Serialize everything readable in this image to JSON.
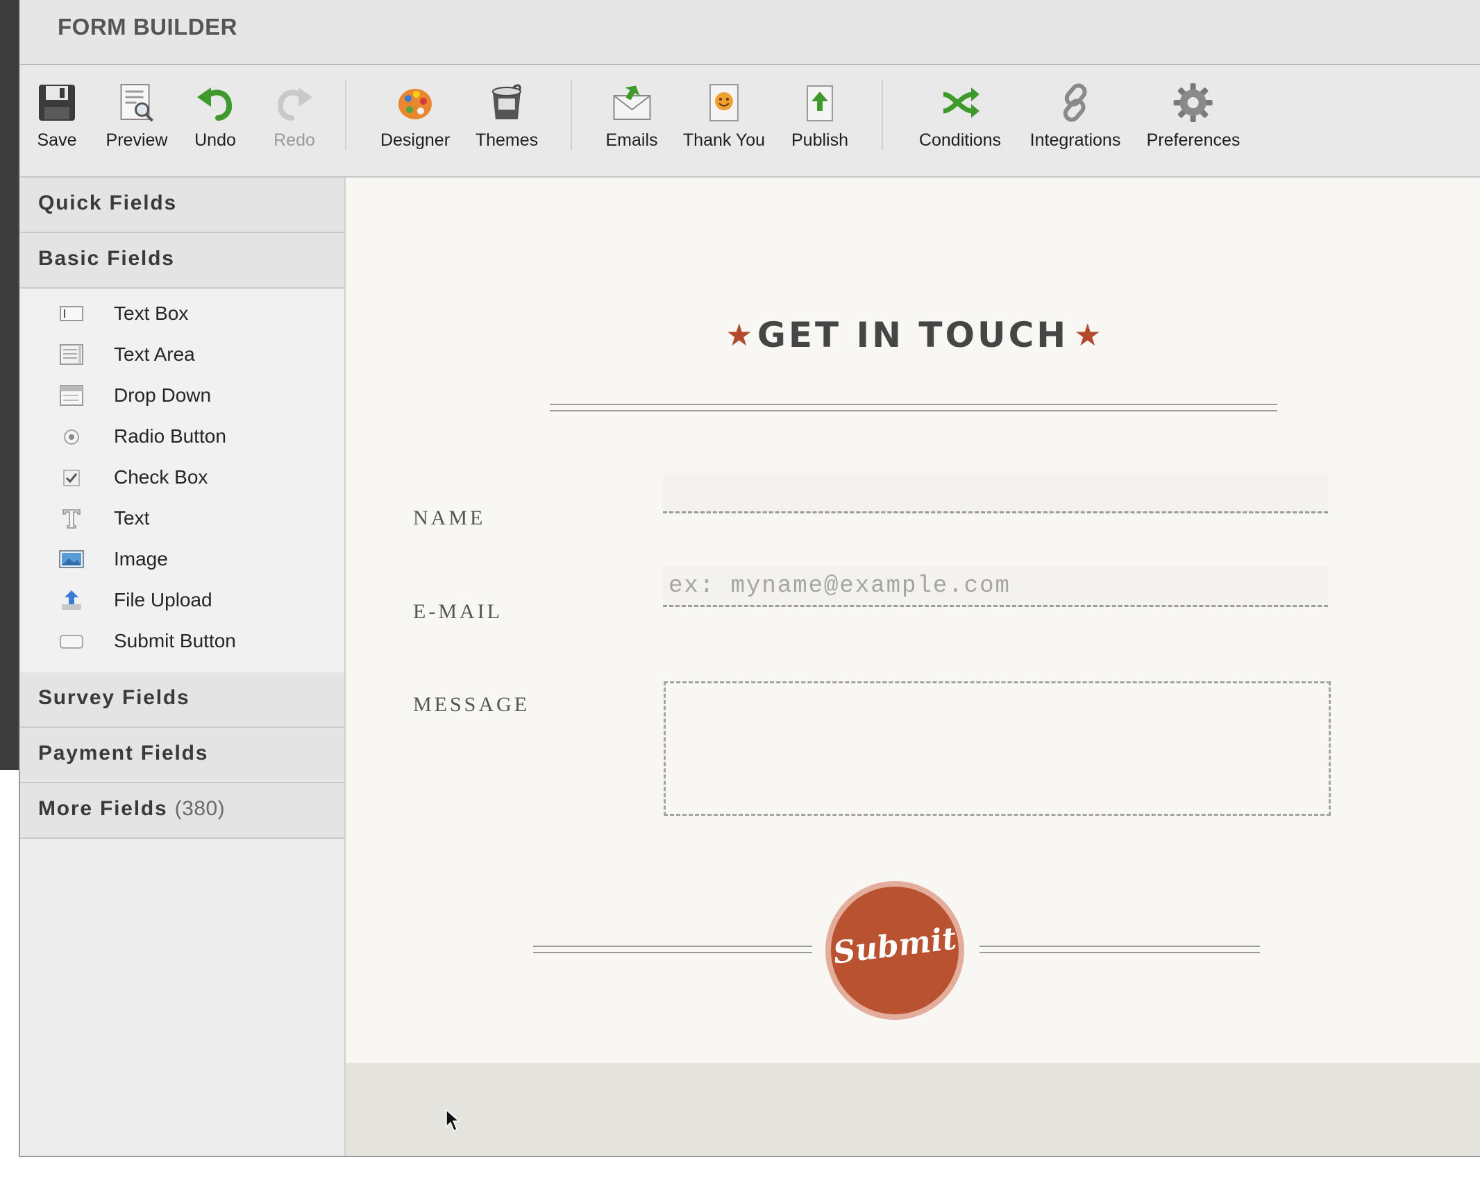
{
  "app": {
    "title": "FORM BUILDER"
  },
  "toolbar": {
    "items": [
      {
        "label": "Save",
        "icon": "floppy-disk-icon",
        "disabled": false
      },
      {
        "label": "Preview",
        "icon": "preview-icon",
        "disabled": false
      },
      {
        "label": "Undo",
        "icon": "undo-arrow-icon",
        "disabled": false
      },
      {
        "label": "Redo",
        "icon": "redo-arrow-icon",
        "disabled": true
      },
      {
        "label": "Designer",
        "icon": "palette-icon",
        "disabled": false
      },
      {
        "label": "Themes",
        "icon": "paint-bucket-icon",
        "disabled": false
      },
      {
        "label": "Emails",
        "icon": "envelope-icon",
        "disabled": false
      },
      {
        "label": "Thank You",
        "icon": "smiley-page-icon",
        "disabled": false
      },
      {
        "label": "Publish",
        "icon": "upload-page-icon",
        "disabled": false
      },
      {
        "label": "Conditions",
        "icon": "crossing-arrows-icon",
        "disabled": false
      },
      {
        "label": "Integrations",
        "icon": "chain-link-icon",
        "disabled": false
      },
      {
        "label": "Preferences",
        "icon": "gear-icon",
        "disabled": false
      }
    ]
  },
  "sidebar": {
    "categories": [
      {
        "label": "Quick Fields"
      },
      {
        "label": "Basic Fields",
        "expanded": true
      },
      {
        "label": "Survey Fields"
      },
      {
        "label": "Payment Fields"
      },
      {
        "label": "More Fields",
        "count": "(380)"
      }
    ],
    "basic_fields": [
      {
        "label": "Text Box",
        "icon": "text-box-icon"
      },
      {
        "label": "Text Area",
        "icon": "text-area-icon"
      },
      {
        "label": "Drop Down",
        "icon": "drop-down-icon"
      },
      {
        "label": "Radio Button",
        "icon": "radio-button-icon"
      },
      {
        "label": "Check Box",
        "icon": "check-box-icon"
      },
      {
        "label": "Text",
        "icon": "text-t-icon"
      },
      {
        "label": "Image",
        "icon": "image-icon"
      },
      {
        "label": "File Upload",
        "icon": "file-upload-icon"
      },
      {
        "label": "Submit Button",
        "icon": "submit-button-icon"
      }
    ]
  },
  "form": {
    "title": "GET IN TOUCH",
    "star": "★",
    "fields": {
      "name": {
        "label": "NAME",
        "value": "",
        "placeholder": ""
      },
      "email": {
        "label": "E-MAIL",
        "value": "",
        "placeholder": "ex: myname@example.com"
      },
      "message": {
        "label": "MESSAGE",
        "value": ""
      }
    },
    "submit_label": "Submit"
  },
  "colors": {
    "accent": "#b85230",
    "star": "#b34a2c",
    "submit_ring": "#e3ac9b",
    "canvas": "#f8f7f3",
    "sidebar": "#ededed",
    "toolbar": "#e9e9e9"
  }
}
